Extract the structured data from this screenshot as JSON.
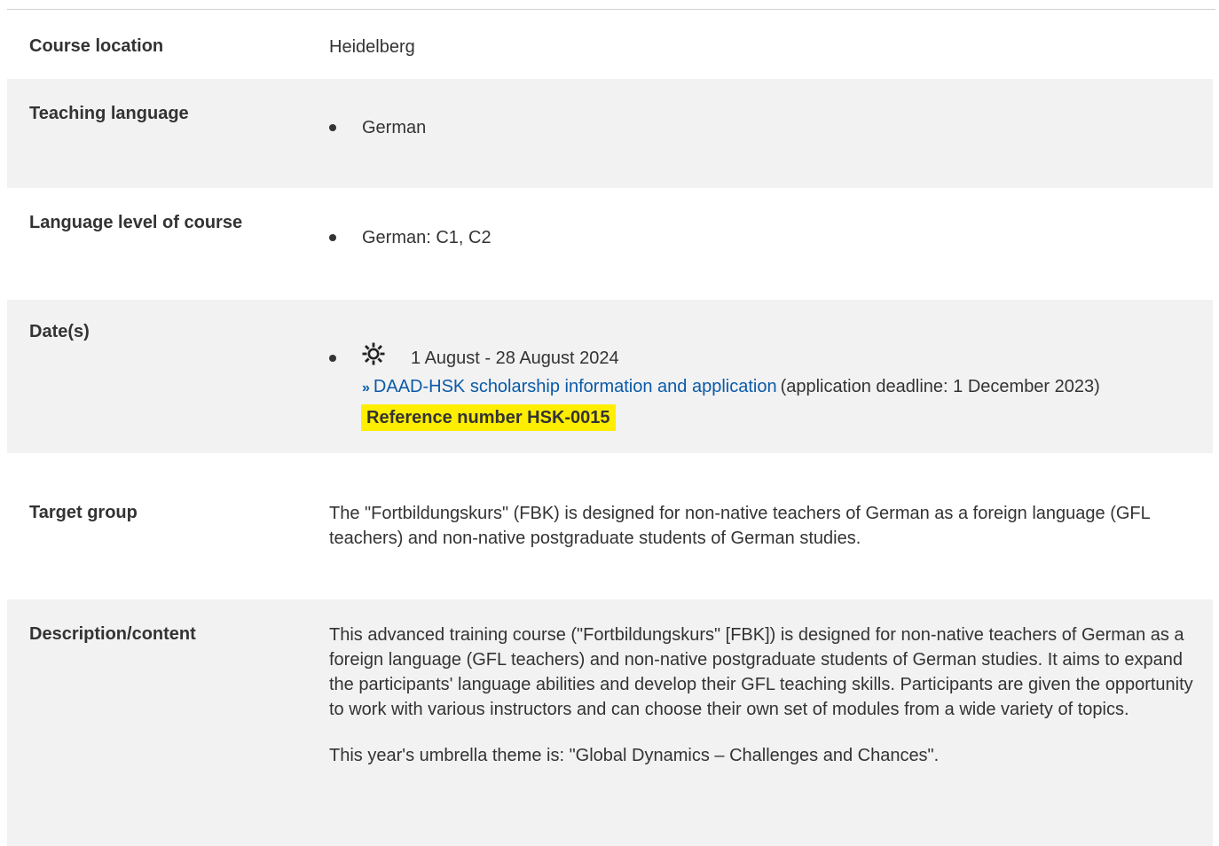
{
  "rows": {
    "course_location": {
      "label": "Course location",
      "value": "Heidelberg"
    },
    "teaching_language": {
      "label": "Teaching language",
      "items": [
        "German"
      ]
    },
    "language_level": {
      "label": "Language level of course",
      "items": [
        "German: C1, C2"
      ]
    },
    "dates": {
      "label": "Date(s)",
      "date_text": "1 August - 28 August 2024",
      "season_icon": "sun-icon",
      "link_text": "DAAD-HSK scholarship information and application",
      "deadline_text": "(application deadline: 1 December 2023)",
      "reference_text": "Reference number HSK-0015"
    },
    "target_group": {
      "label": "Target group",
      "value": "The \"Fortbildungskurs\" (FBK) is designed for non-native teachers of German as a foreign language (GFL teachers) and non-native postgraduate students of German studies."
    },
    "description": {
      "label": "Description/content",
      "paragraphs": [
        "This advanced training course (\"Fortbildungskurs\" [FBK]) is designed for non-native teachers of German as a foreign language (GFL teachers) and non-native postgraduate students of German studies. It aims to expand the participants' language abilities and develop their GFL teaching skills. Participants are given the opportunity to work with various instructors and can choose their own set of modules from a wide variety of topics.",
        "This year's umbrella theme is: \"Global Dynamics – Challenges and Chances\"."
      ]
    }
  },
  "colors": {
    "shaded_row": "#f2f2f2",
    "link": "#0a5aa8",
    "highlight": "#ffee00",
    "text": "#333333"
  }
}
